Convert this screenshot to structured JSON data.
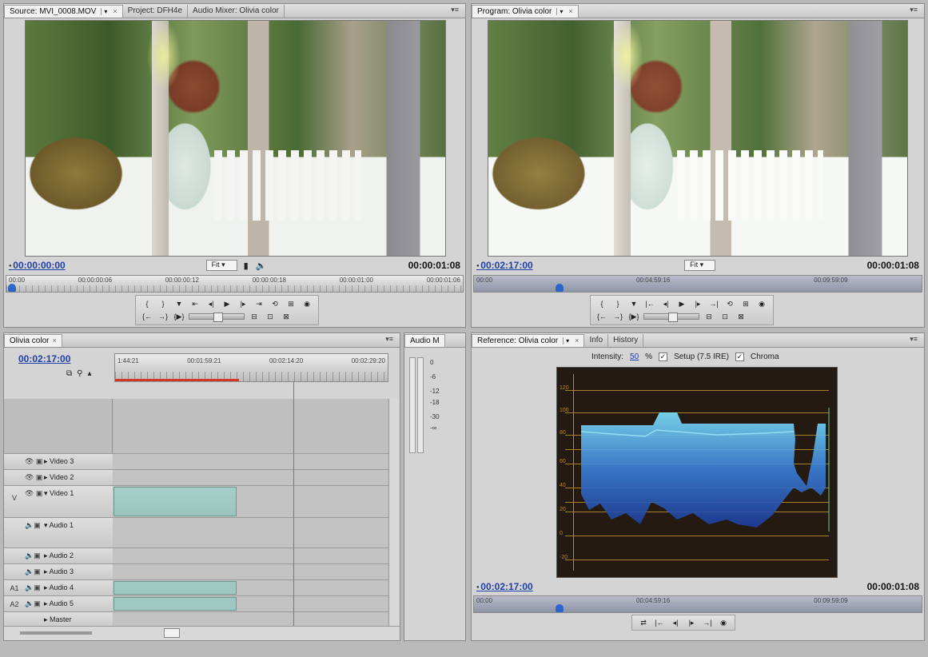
{
  "source_panel": {
    "tabs": [
      "Source: MVI_0008.MOV",
      "Project: DFH4e",
      "Audio Mixer: Olivia color"
    ],
    "timecode_current": "00:00:00:00",
    "timecode_duration": "00:00:01:08",
    "fit_label": "Fit",
    "ruler_labels": [
      "00:00",
      "00:00:00:06",
      "00:00:00:12",
      "00:00:00:18",
      "00:00:01:00",
      "00:00:01:06"
    ]
  },
  "program_panel": {
    "tabs": [
      "Program: Olivia color"
    ],
    "timecode_current": "00:02:17:00",
    "timecode_duration": "00:00:01:08",
    "fit_label": "Fit",
    "ruler_labels": [
      "00:00",
      "00:04:59:16",
      "00:09:59:09"
    ]
  },
  "timeline_panel": {
    "tab": "Olivia color",
    "timecode": "00:02:17:00",
    "ruler_labels": [
      "1:44:21",
      "00:01:59:21",
      "00:02:14:20",
      "00:02:29:20"
    ],
    "tracks": [
      {
        "side": "",
        "name": "Video 3",
        "icons": "👁 🎞"
      },
      {
        "side": "",
        "name": "Video 2",
        "icons": "👁 🎞"
      },
      {
        "side": "V",
        "name": "Video 1",
        "icons": "👁 🎞"
      },
      {
        "side": "",
        "name": "Audio 1",
        "icons": "🔊 🎞"
      },
      {
        "side": "",
        "name": "Audio 2",
        "icons": "🔊 🎞"
      },
      {
        "side": "",
        "name": "Audio 3",
        "icons": "🔊 🎞"
      },
      {
        "side": "A1",
        "name": "Audio 4",
        "icons": "🔊 🎞"
      },
      {
        "side": "A2",
        "name": "Audio 5",
        "icons": "🔊 🎞"
      },
      {
        "side": "",
        "name": "Master",
        "icons": ""
      }
    ]
  },
  "audio_meter": {
    "tab": "Audio M",
    "labels": [
      "0",
      "-6",
      "-12",
      "-18",
      "-30",
      "-∞"
    ]
  },
  "reference_panel": {
    "tabs": [
      "Reference: Olivia color",
      "Info",
      "History"
    ],
    "intensity_label": "Intensity:",
    "intensity_value": "50",
    "intensity_unit": "%",
    "setup_label": "Setup (7.5 IRE)",
    "chroma_label": "Chroma",
    "timecode_current": "00:02:17:00",
    "timecode_duration": "00:00:01:08",
    "ruler_labels": [
      "00:00",
      "00:04:59:16",
      "00:09:59:09"
    ],
    "scope_labels": [
      "120",
      "100",
      "80",
      "60",
      "40",
      "20",
      "0",
      "-20"
    ]
  }
}
